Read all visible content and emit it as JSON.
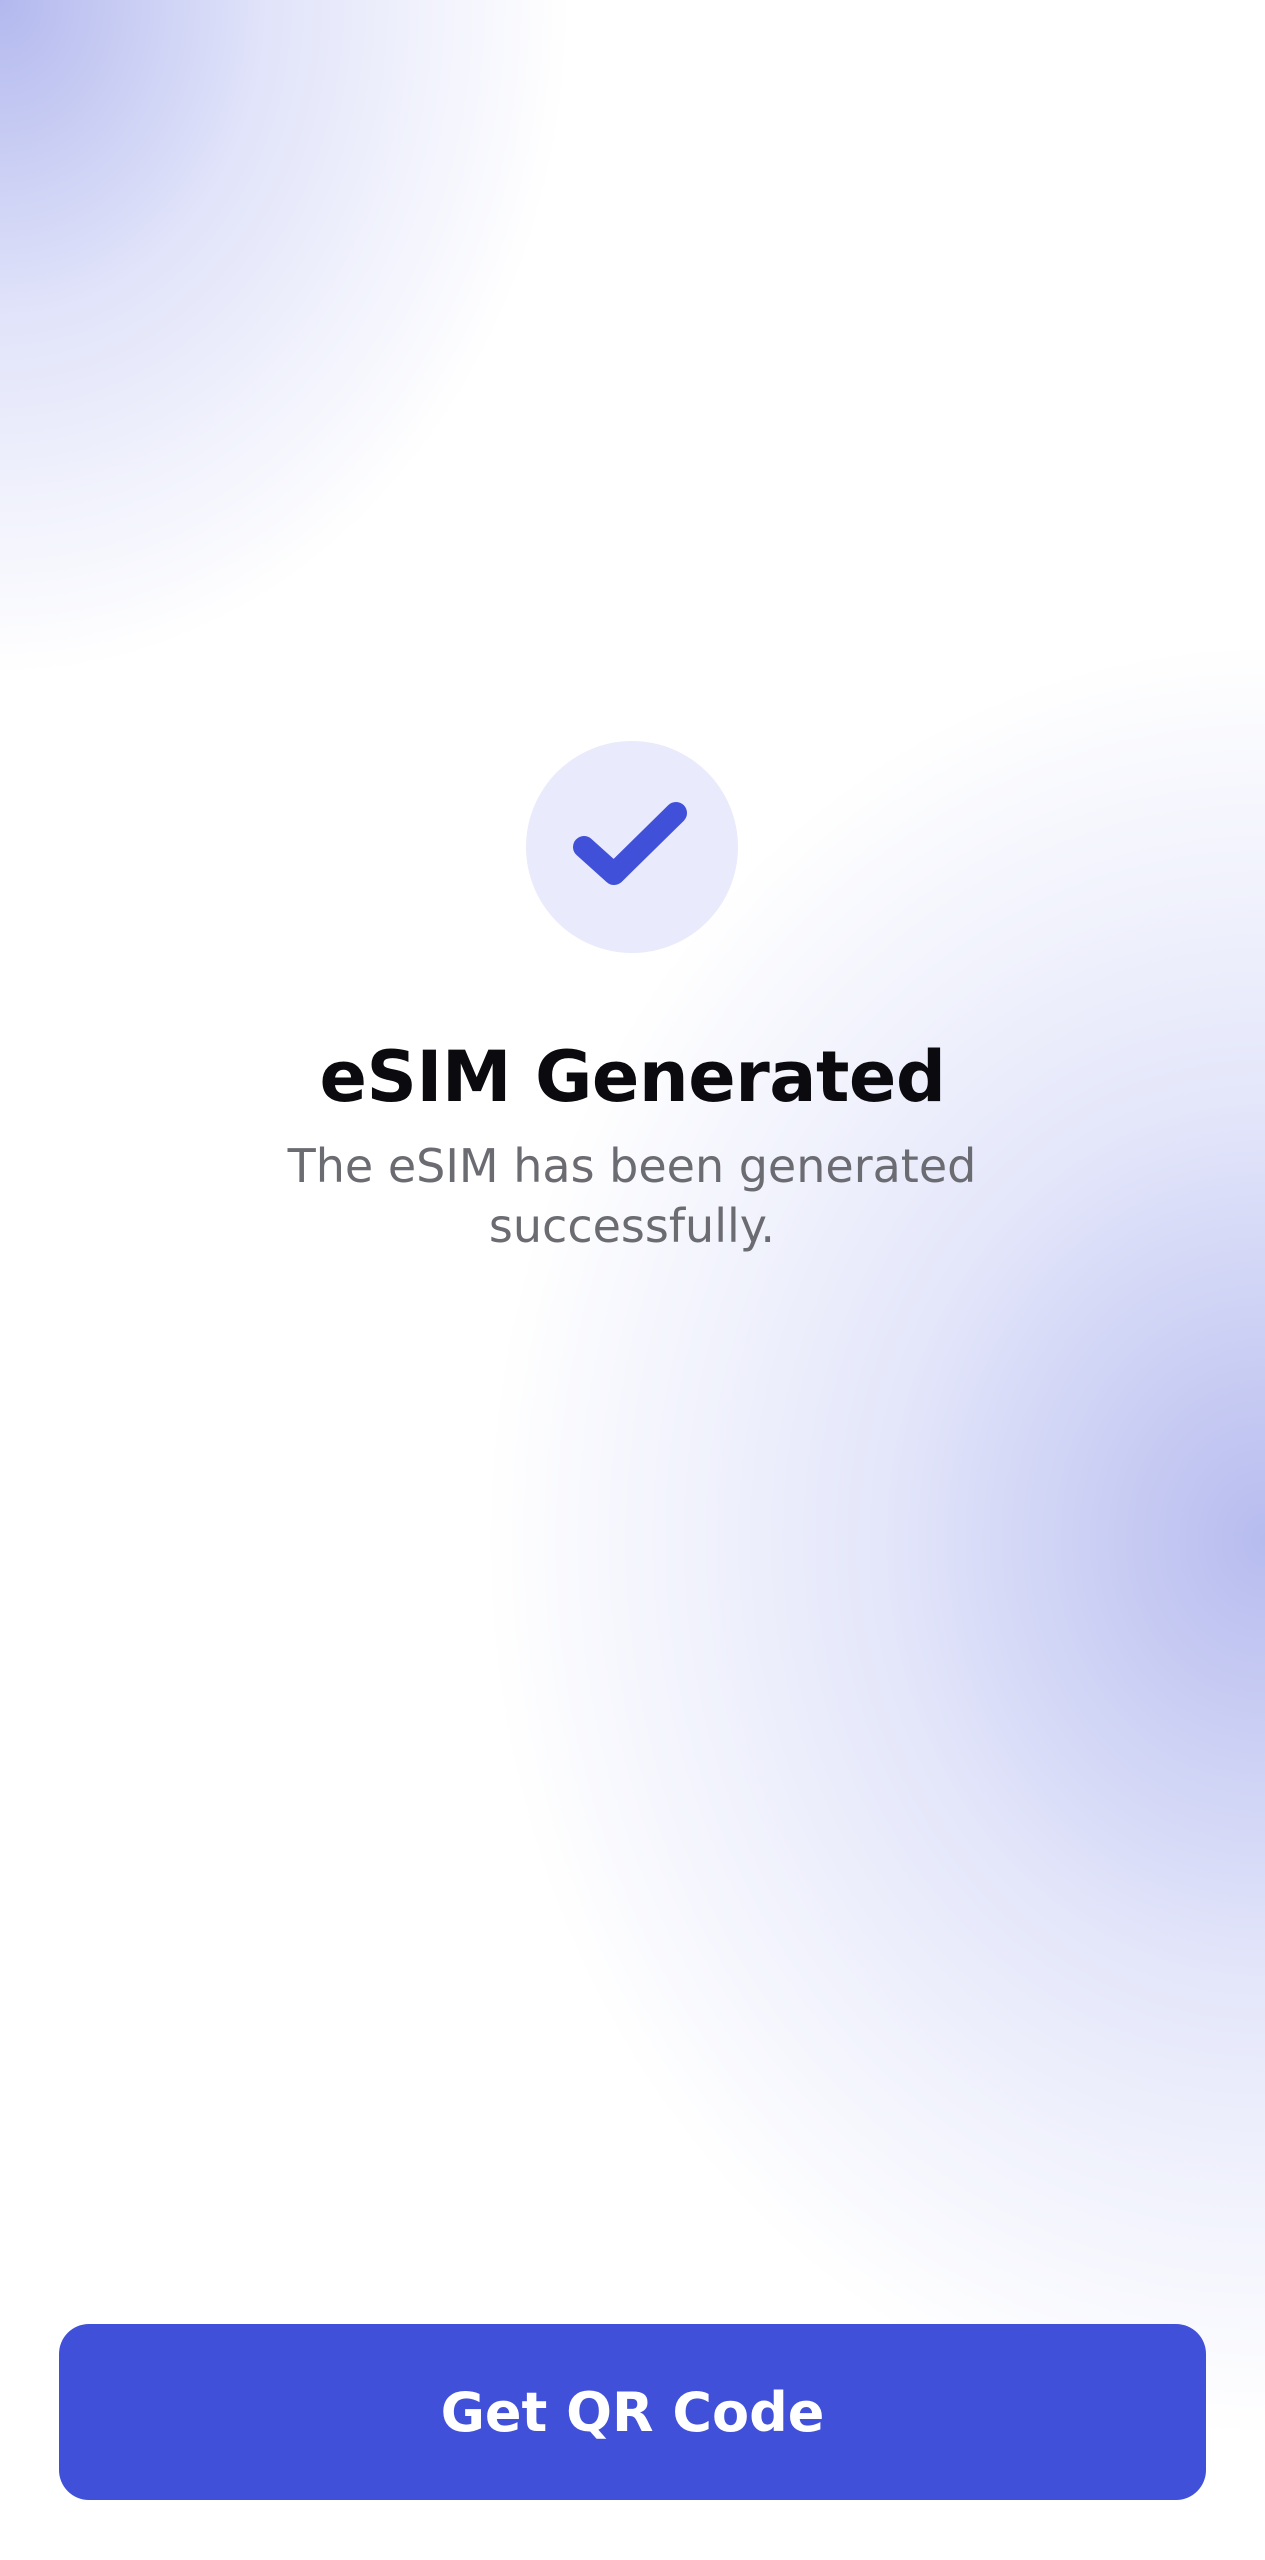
{
  "screen": {
    "icon": "checkmark-icon",
    "title": "eSIM Generated",
    "message": "The eSIM has been generated successfully.",
    "cta_label": "Get QR Code"
  },
  "colors": {
    "accent": "#4150D8",
    "badge_bg": "#E9EAFB",
    "title_text": "#0B0B0F",
    "subtitle_text": "#6B6B72"
  }
}
